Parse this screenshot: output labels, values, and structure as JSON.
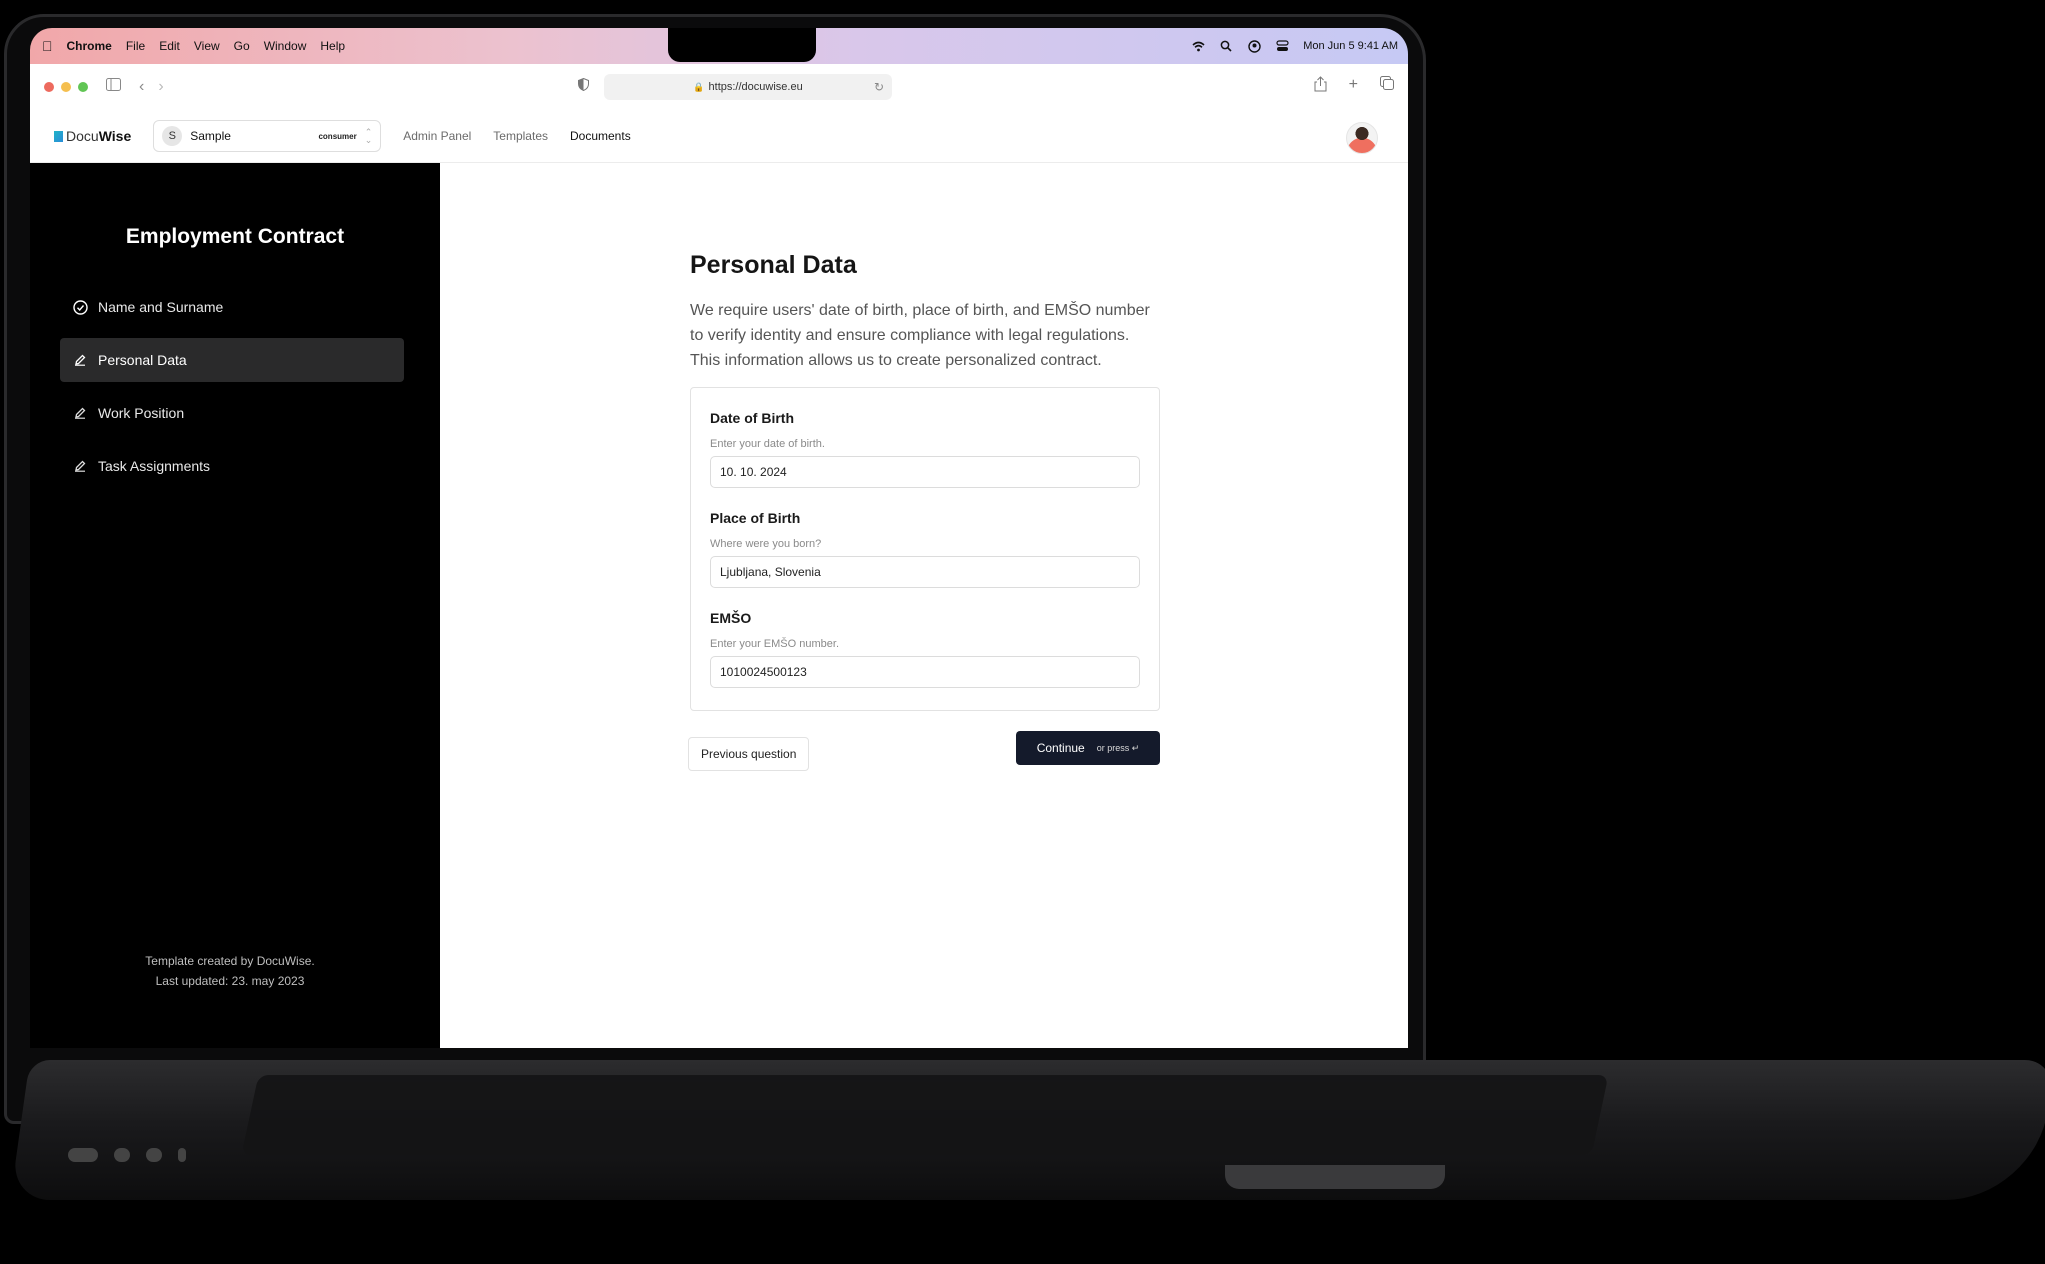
{
  "menubar": {
    "app_name": "Chrome",
    "items": [
      "File",
      "Edit",
      "View",
      "Go",
      "Window",
      "Help"
    ],
    "status_icons": [
      "wifi-icon",
      "search-icon",
      "user-icon",
      "control-center-icon"
    ],
    "datetime": "Mon Jun 5  9:41 AM"
  },
  "browser": {
    "url": "https://docuwise.eu"
  },
  "header": {
    "logo_prefix": "Docu",
    "logo_suffix": "Wise",
    "org": {
      "initial": "S",
      "name": "Sample",
      "role": "consumer"
    },
    "nav": [
      {
        "label": "Admin Panel",
        "active": false
      },
      {
        "label": "Templates",
        "active": false
      },
      {
        "label": "Documents",
        "active": true
      }
    ]
  },
  "sidebar": {
    "title": "Employment Contract",
    "steps": [
      {
        "label": "Name and Surname",
        "status": "completed",
        "icon": "check-circle-icon"
      },
      {
        "label": "Personal Data",
        "status": "active",
        "icon": "pencil-icon"
      },
      {
        "label": "Work Position",
        "status": "pending",
        "icon": "pencil-icon"
      },
      {
        "label": "Task Assignments",
        "status": "pending",
        "icon": "pencil-icon"
      }
    ],
    "footer_line1": "Template created by DocuWise.",
    "footer_line2": "Last updated: 23. may 2023"
  },
  "form": {
    "title": "Personal Data",
    "description": "We require users' date of birth, place of birth, and EMŠO number to verify identity and ensure compliance with legal regulations. This information allows us to create personalized contract.",
    "fields": [
      {
        "label": "Date of Birth",
        "help": "Enter your date of birth.",
        "value": "10. 10. 2024"
      },
      {
        "label": "Place of Birth",
        "help": "Where were you born?",
        "value": "Ljubljana, Slovenia"
      },
      {
        "label": "EMŠO",
        "help": "Enter your EMŠO number.",
        "value": "1010024500123"
      }
    ],
    "previous_label": "Previous question",
    "continue_label": "Continue",
    "continue_hint": "or press ↵"
  },
  "colors": {
    "primary_button": "#141a2b",
    "sidebar_bg": "#000000",
    "sidebar_active": "#2a2a2b"
  }
}
